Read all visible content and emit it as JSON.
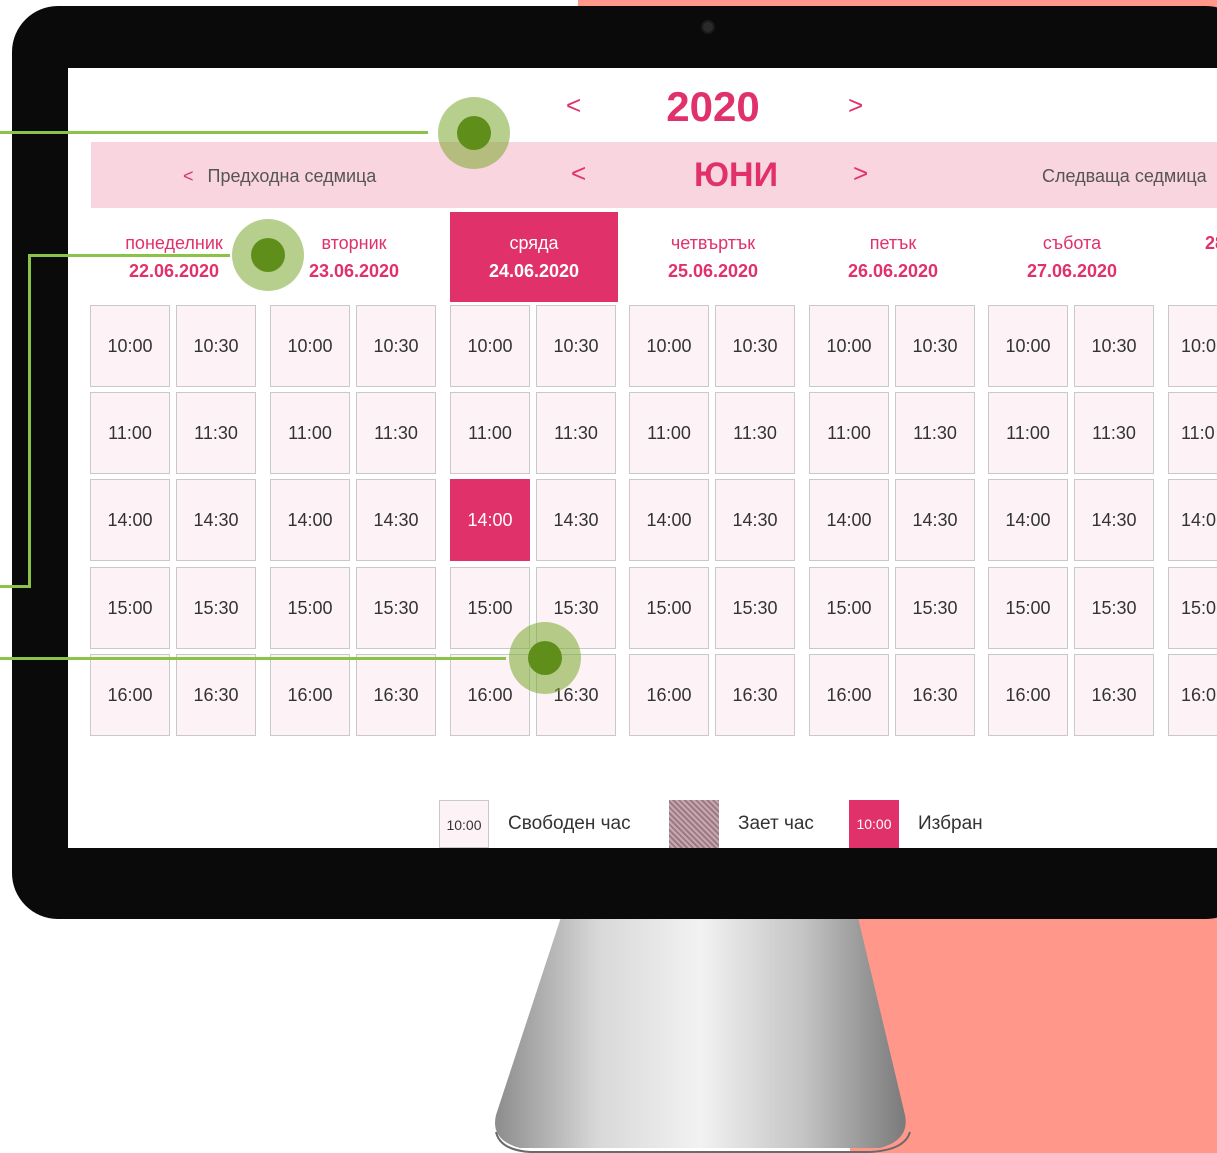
{
  "calendar": {
    "year": "2020",
    "month": "ЮНИ",
    "nav": {
      "prev_arrow": "<",
      "next_arrow": ">",
      "prev_week": "Предходна седмица",
      "next_week": "Следваща седмица"
    },
    "days": [
      {
        "name": "понеделник",
        "date": "22.06.2020"
      },
      {
        "name": "вторник",
        "date": "23.06.2020"
      },
      {
        "name": "сряда",
        "date": "24.06.2020",
        "selected": true
      },
      {
        "name": "четвъртък",
        "date": "25.06.2020"
      },
      {
        "name": "петък",
        "date": "26.06.2020"
      },
      {
        "name": "събота",
        "date": "27.06.2020"
      },
      {
        "name": "",
        "date": "28"
      }
    ],
    "slot_rows": [
      [
        "10:00",
        "10:30"
      ],
      [
        "11:00",
        "11:30"
      ],
      [
        "14:00",
        "14:30"
      ],
      [
        "15:00",
        "15:30"
      ],
      [
        "16:00",
        "16:30"
      ]
    ],
    "last_column_partial": [
      "10:0",
      "11:0",
      "14:0",
      "15:0",
      "16:0"
    ],
    "selected_slot": {
      "day": "24.06.2020",
      "time": "14:00"
    }
  },
  "legend": {
    "free_sample": "10:00",
    "free_label": "Свободен час",
    "busy_label": "Зает час",
    "chosen_sample": "10:00",
    "chosen_label": "Избран"
  },
  "colors": {
    "accent": "#e0316a",
    "month_bar": "#f9d5df",
    "slot_bg": "#fdf3f6",
    "annotation": "#8bc34a",
    "backdrop": "#ff988a"
  }
}
